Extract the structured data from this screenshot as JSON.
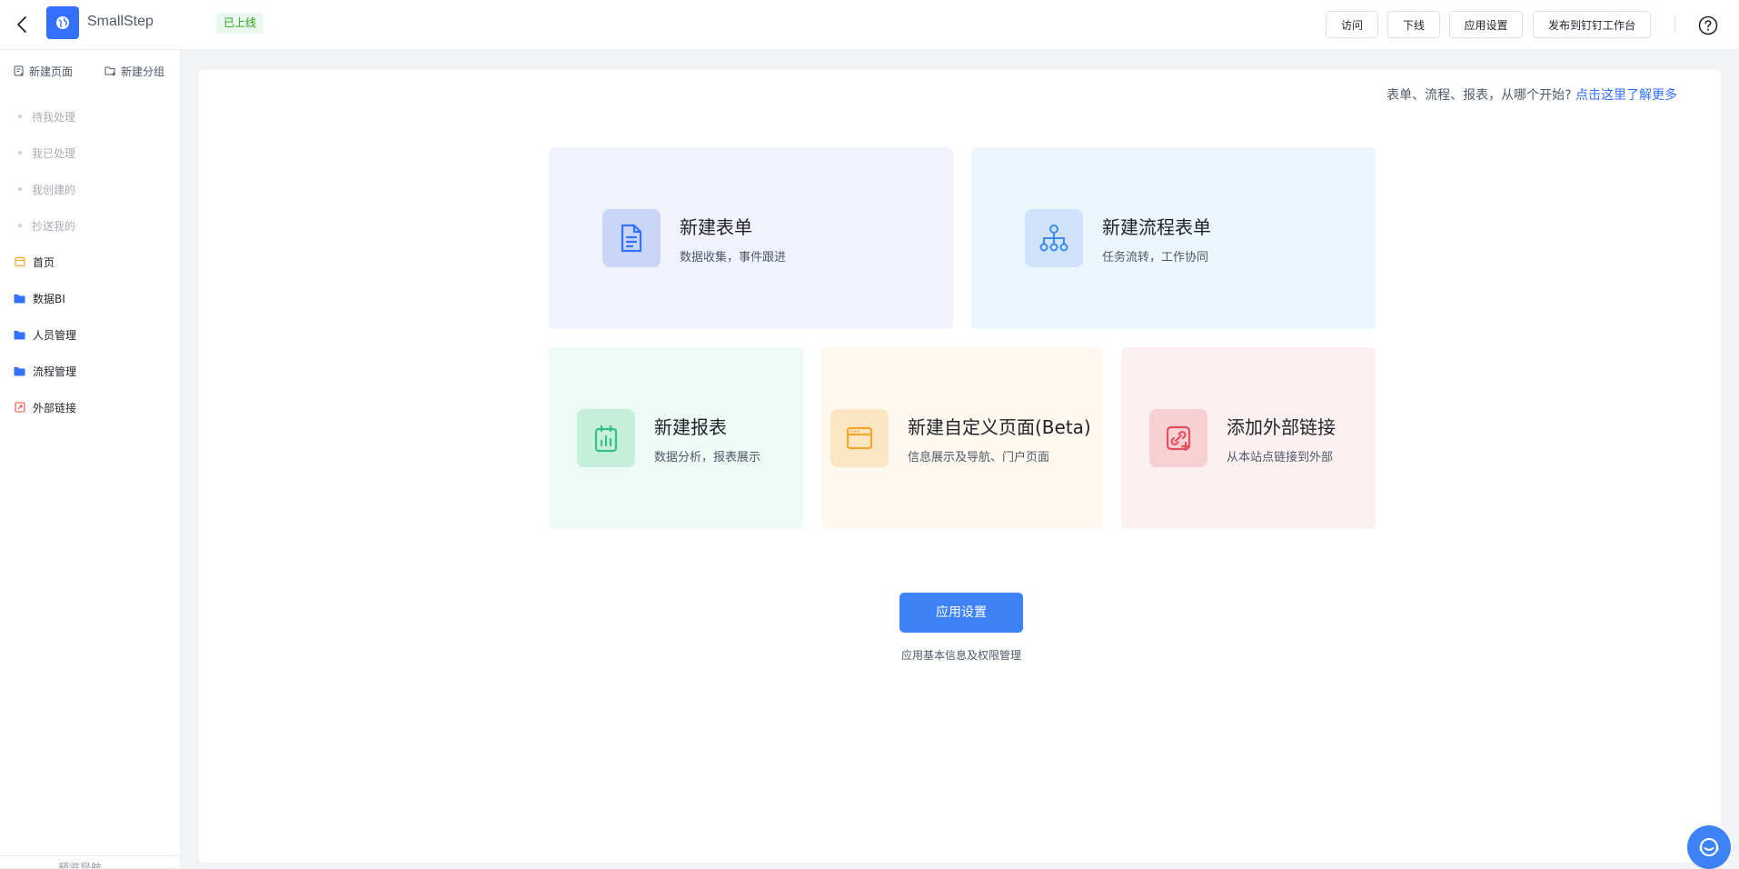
{
  "header": {
    "app_name": "SmallStep",
    "status_badge": "已上线",
    "buttons": {
      "visit": "访问",
      "offline": "下线",
      "app_settings": "应用设置",
      "publish": "发布到钉钉工作台"
    }
  },
  "sidebar": {
    "new_page": "新建页面",
    "new_group": "新建分组",
    "system_items": [
      {
        "label": "待我处理"
      },
      {
        "label": "我已处理"
      },
      {
        "label": "我创建的"
      },
      {
        "label": "抄送我的"
      }
    ],
    "items": [
      {
        "label": "首页",
        "icon": "page-icon",
        "color": "#f5a623"
      },
      {
        "label": "数据BI",
        "icon": "folder-icon",
        "color": "#3370ff"
      },
      {
        "label": "人员管理",
        "icon": "folder-icon",
        "color": "#3370ff"
      },
      {
        "label": "流程管理",
        "icon": "folder-icon",
        "color": "#3370ff"
      },
      {
        "label": "外部链接",
        "icon": "link-icon",
        "color": "#f54a45"
      }
    ],
    "preview_nav": "预览导航"
  },
  "main": {
    "hint_text": "表单、流程、报表，从哪个开始?",
    "hint_link": "点击这里了解更多",
    "cards": [
      {
        "title": "新建表单",
        "desc": "数据收集，事件跟进",
        "bg": "#f0f3fd",
        "icon_bg": "#c9d6f7",
        "icon_color": "#3370ff"
      },
      {
        "title": "新建流程表单",
        "desc": "任务流转，工作协同",
        "bg": "#edf5fd",
        "icon_bg": "#cfe4fa",
        "icon_color": "#3d8cf0"
      },
      {
        "title": "新建报表",
        "desc": "数据分析，报表展示",
        "bg": "#eefaf5",
        "icon_bg": "#c5eedb",
        "icon_color": "#34c186"
      },
      {
        "title": "新建自定义页面(Beta)",
        "desc": "信息展示及导航、门户页面",
        "bg": "#fef8ee",
        "icon_bg": "#fae6c3",
        "icon_color": "#f0a72c"
      },
      {
        "title": "添加外部链接",
        "desc": "从本站点链接到外部",
        "bg": "#fdf0f1",
        "icon_bg": "#f6d1d4",
        "icon_color": "#e5505f"
      }
    ],
    "settings_button": "应用设置",
    "settings_desc": "应用基本信息及权限管理"
  },
  "colors": {
    "accent": "#3370ff",
    "primary_button": "#3d83f7",
    "online_badge_text": "#2ea121"
  }
}
